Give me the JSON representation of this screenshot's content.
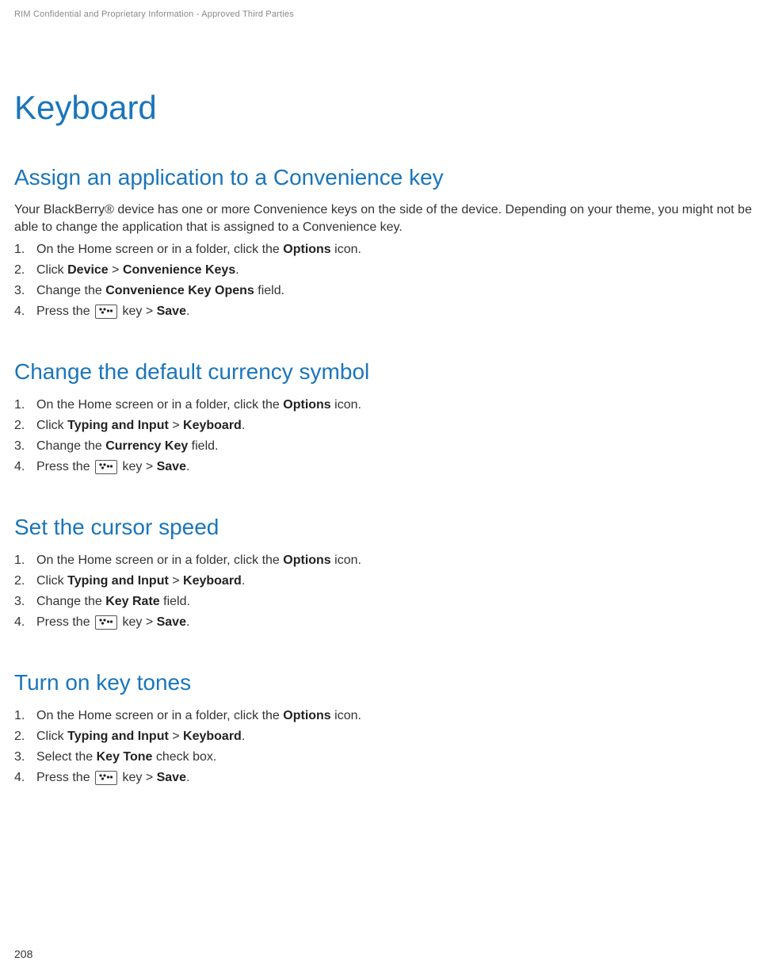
{
  "header": {
    "confidential": "RIM Confidential and Proprietary Information - Approved Third Parties"
  },
  "page": {
    "title": "Keyboard",
    "number": "208"
  },
  "sections": [
    {
      "heading": "Assign an application to a Convenience key",
      "intro": "Your BlackBerry® device has one or more Convenience keys on the side of the device. Depending on your theme, you might not be able to change the application that is assigned to a Convenience key.",
      "steps": [
        {
          "pre": "On the Home screen or in a folder, click the ",
          "bold1": "Options",
          "post1": " icon."
        },
        {
          "pre": "Click ",
          "bold1": "Device",
          "mid": " > ",
          "bold2": "Convenience Keys",
          "post": "."
        },
        {
          "pre": "Change the ",
          "bold1": "Convenience Key Opens",
          "post1": " field."
        },
        {
          "pre": "Press the ",
          "icon": true,
          "mid": " key > ",
          "bold1": "Save",
          "post": "."
        }
      ]
    },
    {
      "heading": "Change the default currency symbol",
      "intro": "",
      "steps": [
        {
          "pre": "On the Home screen or in a folder, click the ",
          "bold1": "Options",
          "post1": " icon."
        },
        {
          "pre": "Click ",
          "bold1": "Typing and Input",
          "mid": " > ",
          "bold2": "Keyboard",
          "post": "."
        },
        {
          "pre": "Change the ",
          "bold1": "Currency Key",
          "post1": " field."
        },
        {
          "pre": "Press the ",
          "icon": true,
          "mid": " key > ",
          "bold1": "Save",
          "post": "."
        }
      ]
    },
    {
      "heading": "Set the cursor speed",
      "intro": "",
      "steps": [
        {
          "pre": "On the Home screen or in a folder, click the ",
          "bold1": "Options",
          "post1": " icon."
        },
        {
          "pre": "Click ",
          "bold1": "Typing and Input",
          "mid": " > ",
          "bold2": "Keyboard",
          "post": "."
        },
        {
          "pre": "Change the ",
          "bold1": "Key Rate",
          "post1": " field."
        },
        {
          "pre": "Press the ",
          "icon": true,
          "mid": " key > ",
          "bold1": "Save",
          "post": "."
        }
      ]
    },
    {
      "heading": "Turn on key tones",
      "intro": "",
      "steps": [
        {
          "pre": "On the Home screen or in a folder, click the ",
          "bold1": "Options",
          "post1": " icon."
        },
        {
          "pre": "Click ",
          "bold1": "Typing and Input",
          "mid": " > ",
          "bold2": "Keyboard",
          "post": "."
        },
        {
          "pre": "Select the ",
          "bold1": "Key Tone",
          "post1": " check box."
        },
        {
          "pre": "Press the ",
          "icon": true,
          "mid": " key > ",
          "bold1": "Save",
          "post": "."
        }
      ]
    }
  ]
}
